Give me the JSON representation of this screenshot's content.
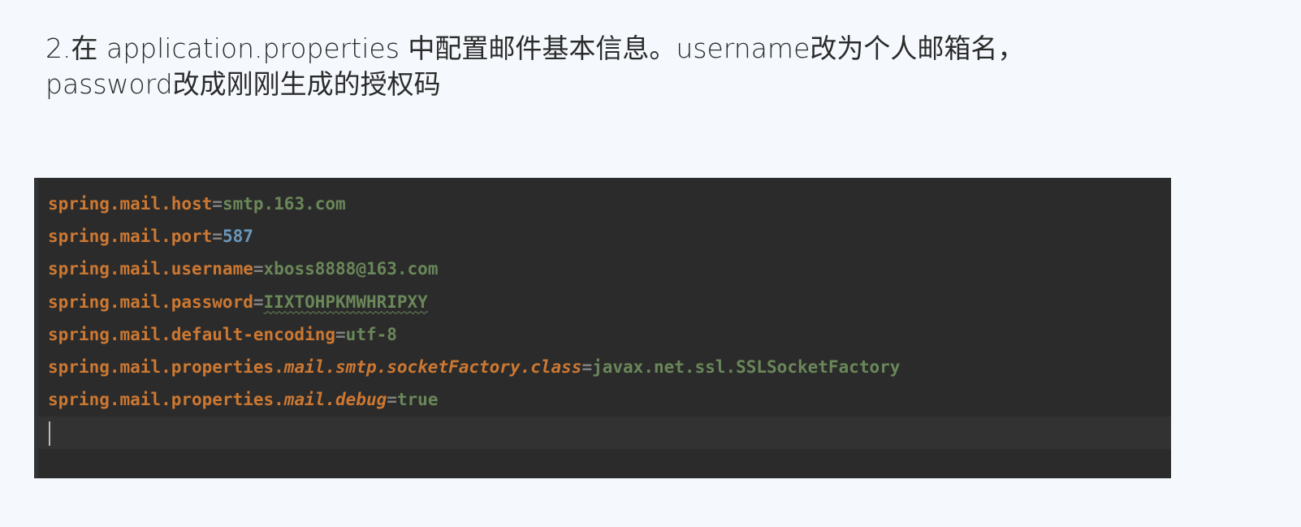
{
  "instruction": {
    "line1": "2.在 application.properties 中配置邮件基本信息。username改为个人邮箱名，",
    "line2": "password改成刚刚生成的授权码"
  },
  "code": {
    "lines": [
      {
        "key": "spring.mail.host",
        "value": "smtp.163.com"
      },
      {
        "key": "spring.mail.port",
        "value": "587"
      },
      {
        "key": "spring.mail.username",
        "value": "xboss8888@163.com"
      },
      {
        "key": "spring.mail.password",
        "value": "IIXTOHPKMWHRIPXY"
      },
      {
        "key": "spring.mail.default-encoding",
        "value": "utf-8"
      },
      {
        "key_prefix": "spring.mail.properties.",
        "key_italic": "mail.smtp.socketFactory.class",
        "value": "javax.net.ssl.SSLSocketFactory"
      },
      {
        "key_prefix": "spring.mail.properties.",
        "key_italic": "mail.debug",
        "value": "true"
      }
    ],
    "equals": "="
  },
  "colors": {
    "key": "#cc7832",
    "value": "#6a8759",
    "number": "#6897bb",
    "background": "#2b2b2b",
    "page": "#f5f9fd"
  }
}
